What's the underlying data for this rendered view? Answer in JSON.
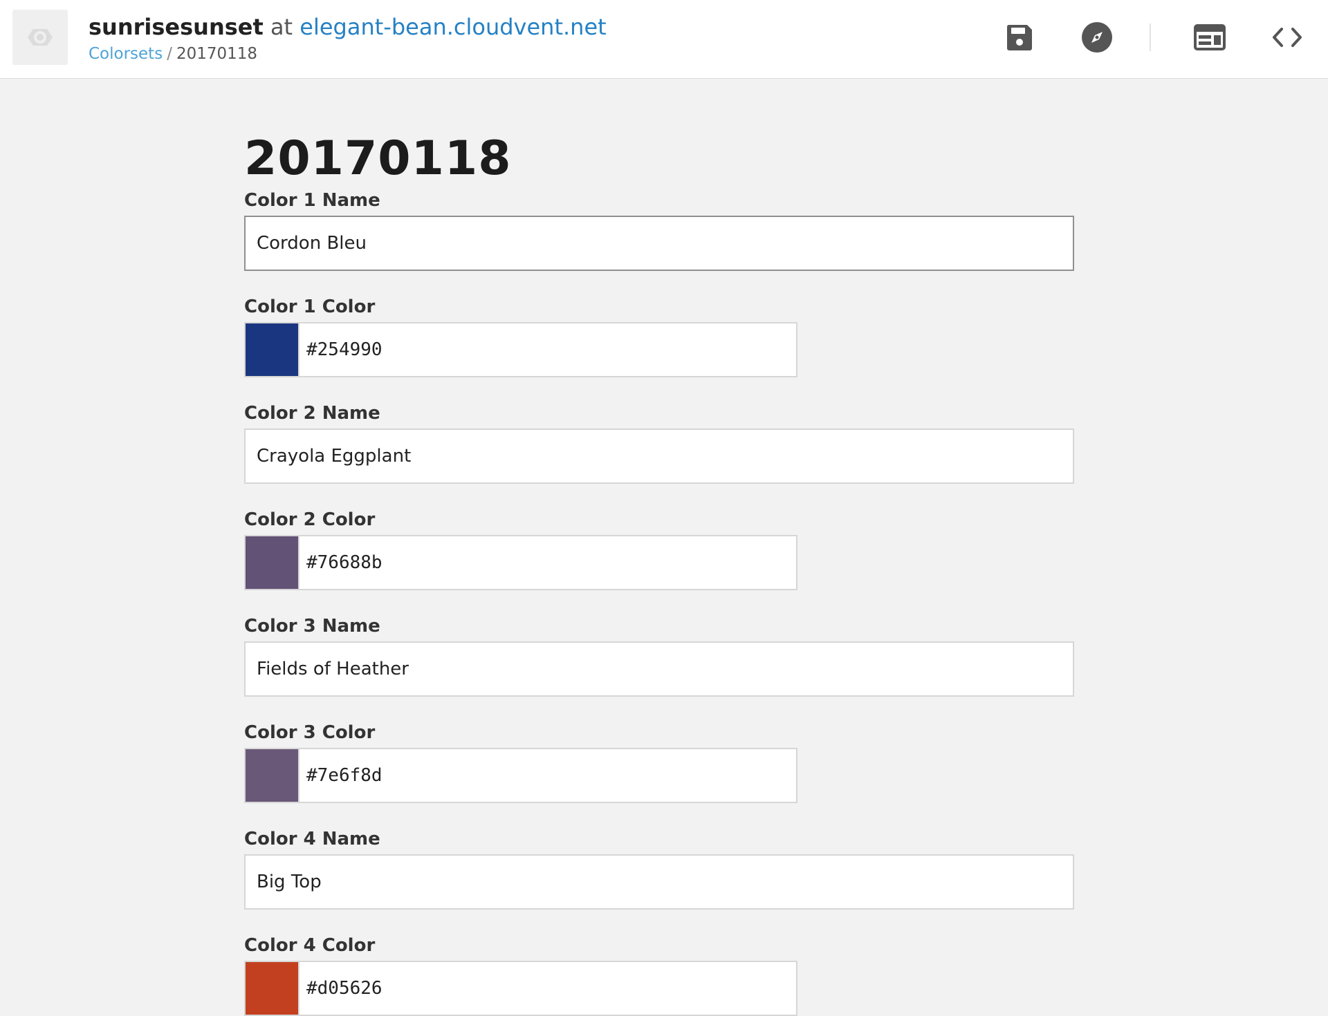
{
  "header": {
    "site_name": "sunrisesunset",
    "at_text": "at",
    "host": "elegant-bean.cloudvent.net",
    "breadcrumb": {
      "parent": "Colorsets",
      "separator": "/",
      "current": "20170118"
    },
    "tools": {
      "save_icon": "save-icon",
      "explore_icon": "compass-icon",
      "visual_icon": "layout-icon",
      "source_icon": "code-icon"
    }
  },
  "page": {
    "title": "20170118",
    "fields": [
      {
        "label": "Color 1 Name",
        "value": "Cordon Bleu"
      },
      {
        "label": "Color 1 Color",
        "hex": "#254990",
        "swatch": "#1b3680"
      },
      {
        "label": "Color 2 Name",
        "value": "Crayola Eggplant"
      },
      {
        "label": "Color 2 Color",
        "hex": "#76688b",
        "swatch": "#625275"
      },
      {
        "label": "Color 3 Name",
        "value": "Fields of Heather"
      },
      {
        "label": "Color 3 Color",
        "hex": "#7e6f8d",
        "swatch": "#6a5878"
      },
      {
        "label": "Color 4 Name",
        "value": "Big Top"
      },
      {
        "label": "Color 4 Color",
        "hex": "#d05626",
        "swatch": "#c24020"
      }
    ]
  },
  "colors": {
    "accent": "#2581c4",
    "breadcrumb_link": "#4ea3d6",
    "icon": "#555555",
    "background": "#f2f2f2"
  }
}
